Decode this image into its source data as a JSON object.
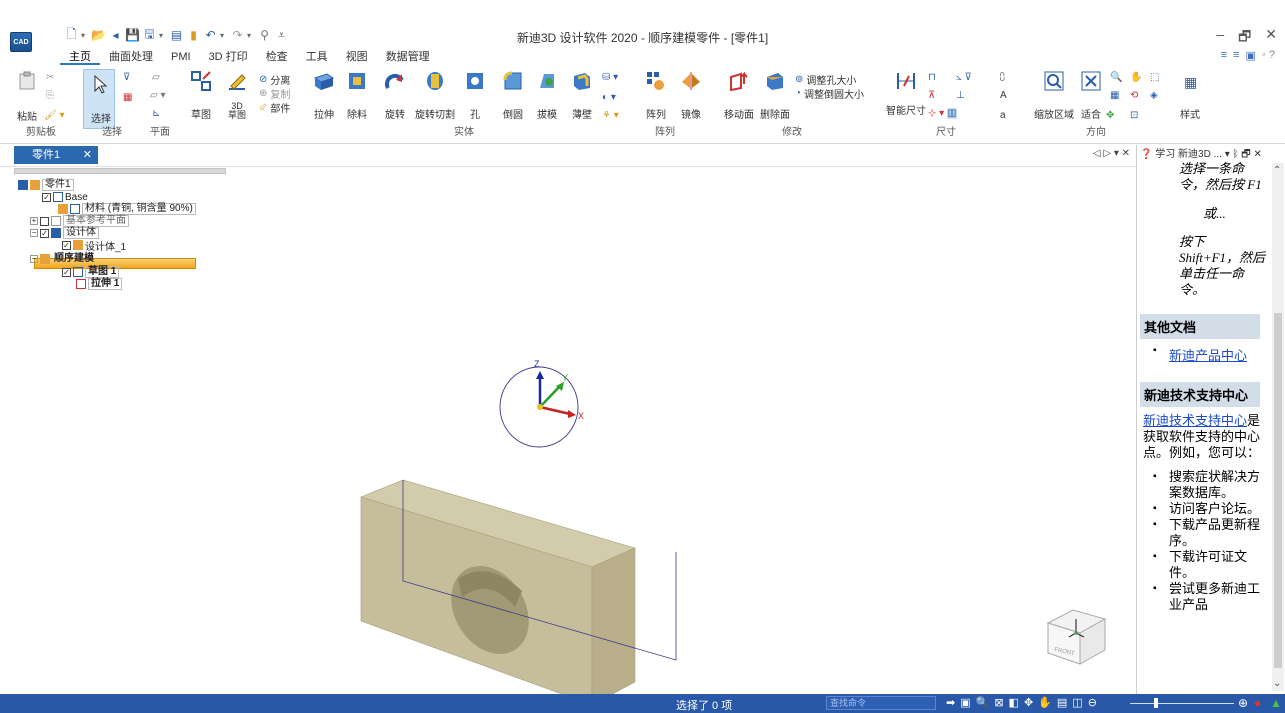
{
  "window": {
    "title": "新迪3D 设计软件 2020 - 顺序建模零件 - [零件1]",
    "logo_text": "CAD",
    "controls": [
      "–",
      "🗗",
      "✕"
    ]
  },
  "tabs": [
    "主页",
    "曲面处理",
    "PMI",
    "3D 打印",
    "检查",
    "工具",
    "视图",
    "数据管理"
  ],
  "ribbon": {
    "clipboard": {
      "paste": "粘贴",
      "group": "剪贴板"
    },
    "select": {
      "select": "选择",
      "group": "选择"
    },
    "plane": {
      "group": "平面"
    },
    "sketch": {
      "sketch": "草图",
      "sketch3d": "3D\n草图",
      "split": "分离",
      "copy": "复制",
      "part": "部件"
    },
    "solid": {
      "extrude": "拉伸",
      "cut": "除料",
      "revolve": "旋转",
      "revolve_cut": "旋转切割",
      "hole": "孔",
      "round": "倒圆",
      "draft": "拔模",
      "thin": "薄壁",
      "group": "实体"
    },
    "array": {
      "pattern": "阵列",
      "mirror": "镜像",
      "group": "阵列"
    },
    "modify": {
      "move_face": "移动面",
      "delete_face": "删除面",
      "adjust_hole": "调整孔大小",
      "adjust_round": "调整倒圆大小",
      "group": "修改"
    },
    "dimension": {
      "smart_dim": "智能尺寸",
      "group": "尺寸"
    },
    "orient": {
      "zoom_area": "缩放区域",
      "fit": "适合",
      "group": "方向"
    },
    "style": {
      "style": "样式"
    }
  },
  "doc_tab": {
    "label": "零件1",
    "close": "✕",
    "controls": "◁ ▷ ▾ ✕"
  },
  "tree": {
    "root": "零件1",
    "base": "Base",
    "material": "材料 (青铜, 铜含量 90%)",
    "ref_planes": "基本参考平面",
    "design_body": "设计体",
    "design_body_1": "设计体_1",
    "ordered": "顺序建模",
    "sketch1": "草图 1",
    "extrude1": "拉伸 1"
  },
  "axes": {
    "x": "X",
    "y": "Y",
    "z": "Z"
  },
  "view_cube": {
    "face": "FRONT"
  },
  "help": {
    "title": "学习 新迪3D ...",
    "title_ctrls": "▾ ᛒ 🗗 ✕",
    "line1": "选择一条命令，然后按 F1",
    "or": "或...",
    "line2": "按下 Shift+F1，然后单击任一命令。",
    "other_docs": "其他文档",
    "product_center": "新迪产品中心",
    "support_head": "新迪技术支持中心",
    "support_link": "新迪技术支持中心",
    "support_text": "是获取软件支持的中心点。例如，您可以：",
    "items": [
      "搜索症状解决方案数据库。",
      "访问客户论坛。",
      "下载产品更新程序。",
      "下载许可证文件。",
      "尝试更多新迪工业产品"
    ]
  },
  "status": {
    "selected": "选择了 0 项",
    "search_placeholder": "查找命令"
  },
  "colors": {
    "part_top": "#cdc6a6",
    "part_front": "#c2ba96",
    "part_side": "#b4ab86",
    "accent": "#2a58a8"
  }
}
